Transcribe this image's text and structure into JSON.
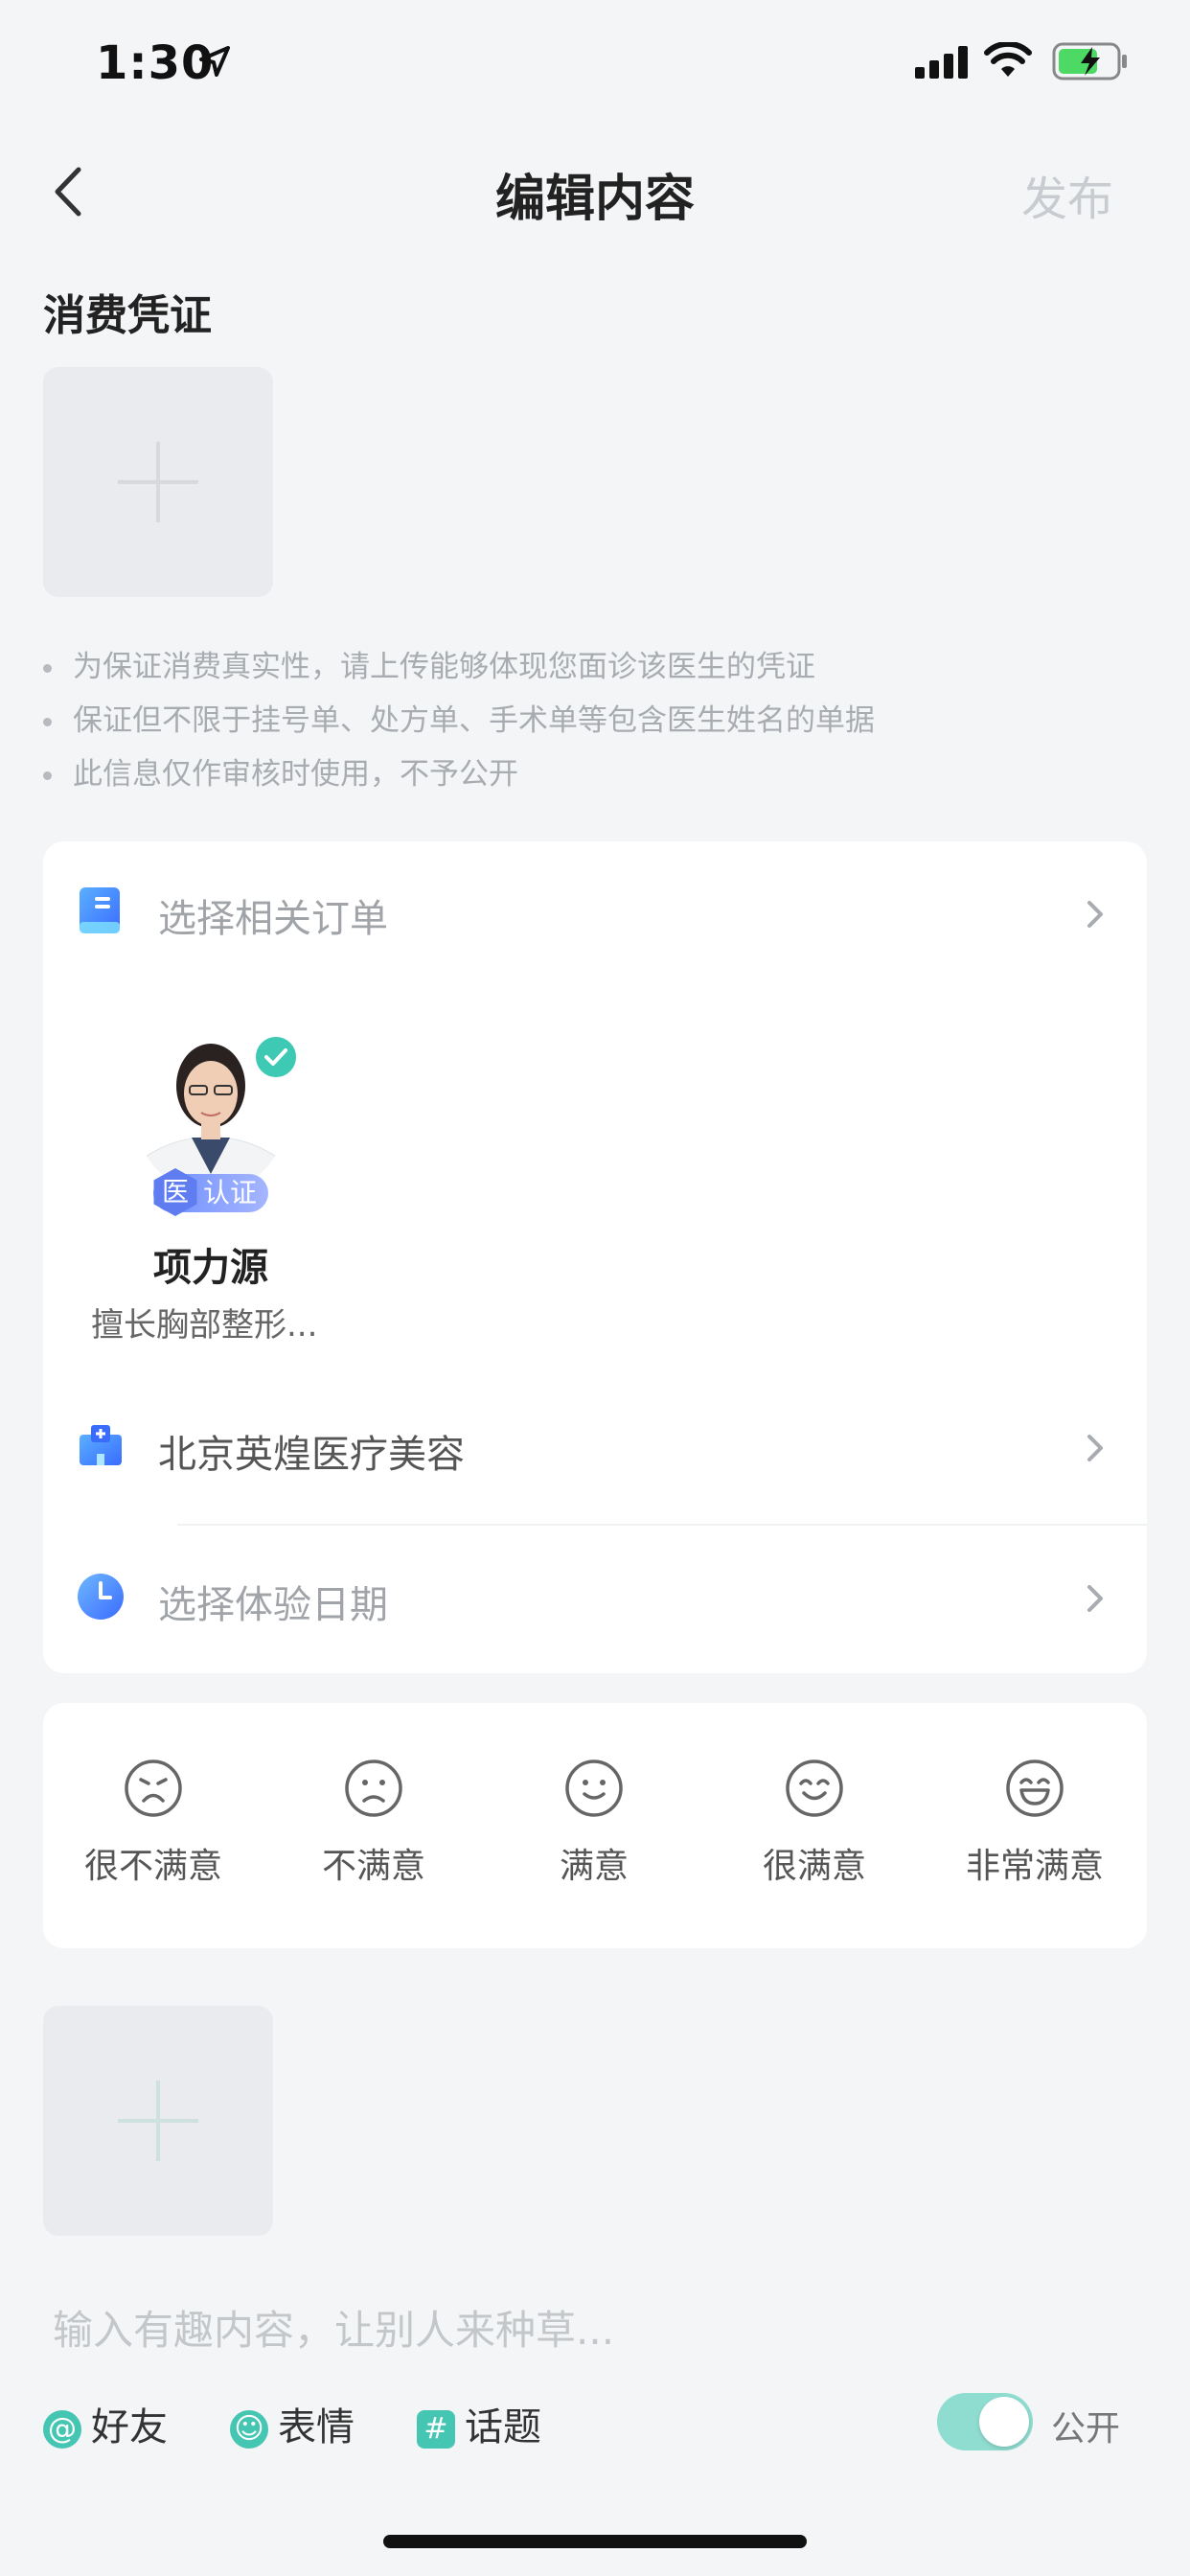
{
  "status_bar": {
    "time": "1:30"
  },
  "nav": {
    "title": "编辑内容",
    "publish": "发布"
  },
  "voucher": {
    "title": "消费凭证",
    "tips": [
      "为保证消费真实性，请上传能够体现您面诊该医生的凭证",
      "保证但不限于挂号单、处方单、手术单等包含医生姓名的单据",
      "此信息仅作审核时使用，不予公开"
    ]
  },
  "order": {
    "label": "选择相关订单"
  },
  "doctor": {
    "name": "项力源",
    "desc": "擅长胸部整形...",
    "badge_yi": "医",
    "badge_text": "认证"
  },
  "hospital": {
    "label": "北京英煌医疗美容"
  },
  "date": {
    "label": "选择体验日期"
  },
  "ratings": [
    "很不满意",
    "不满意",
    "满意",
    "很满意",
    "非常满意"
  ],
  "content": {
    "placeholder": "输入有趣内容，让别人来种草..."
  },
  "toolbar": {
    "friends": "好友",
    "emoji": "表情",
    "topic": "话题",
    "public_label": "公开",
    "public_on": true
  },
  "colors": {
    "accent": "#45c6b3",
    "background": "#f3f5f7"
  }
}
